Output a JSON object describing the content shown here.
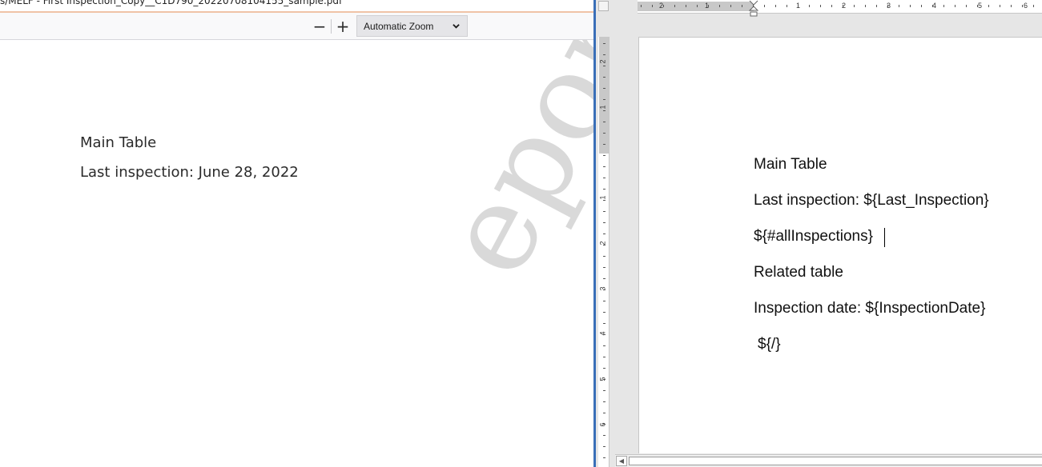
{
  "pdf_viewer": {
    "title_fragment": "s/MELF - First Inspection_Copy__C1D790_20220708104155_sample.pdf",
    "toolbar": {
      "zoom_out_label": "−",
      "zoom_in_label": "+",
      "zoom_value": "Automatic Zoom"
    },
    "page": {
      "heading": "Main Table",
      "last_inspection": "Last inspection: June 28, 2022",
      "watermark": "epor"
    }
  },
  "word_document": {
    "ruler": {
      "horizontal_labels": [
        "2",
        "1",
        "1",
        "1",
        "2",
        "3",
        "4",
        "5",
        "6"
      ],
      "vertical_labels": [
        "2",
        "1",
        "1",
        "1",
        "2",
        "3",
        "4",
        "5",
        "6"
      ]
    },
    "page": {
      "heading": "Main Table",
      "last_inspection": "Last inspection: ${Last_Inspection}",
      "loop_start": "${#allInspections}",
      "related_table": "Related table",
      "inspection_date": "Inspection date: ${InspectionDate}",
      "loop_end": "${/}"
    },
    "scrollbar": {
      "left_arrow": "◀"
    }
  },
  "colors": {
    "divider": "#3a6fb8",
    "title_border": "#f0c3a6",
    "watermark": "#d9d9d9"
  }
}
